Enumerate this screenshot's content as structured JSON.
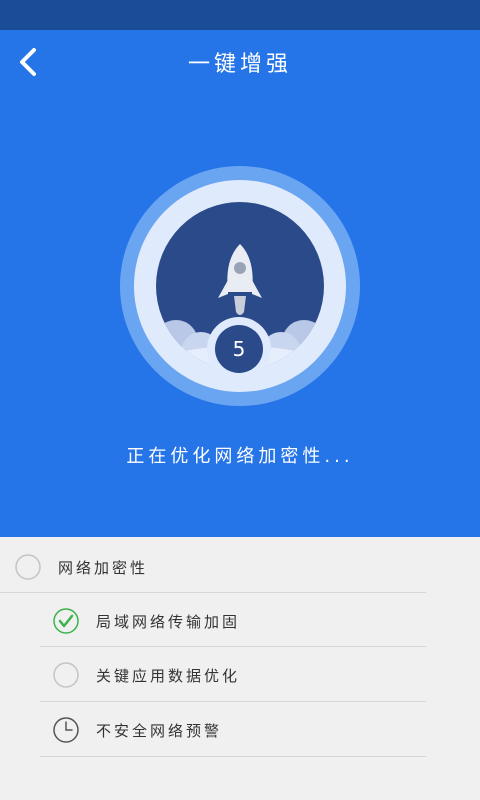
{
  "header": {
    "title": "一键增强"
  },
  "progress": {
    "countdown": "5",
    "status_text": "正在优化网络加密性..."
  },
  "list": {
    "section_title": "网络加密性",
    "items": [
      {
        "label": "局域网络传输加固",
        "state": "done"
      },
      {
        "label": "关键应用数据优化",
        "state": "pending"
      },
      {
        "label": "不安全网络预警",
        "state": "waiting"
      }
    ]
  },
  "colors": {
    "status_bar": "#1a4d98",
    "hero_bg": "#2574e8",
    "ring_outer": "#6aa5f2",
    "ring_light": "#dfeafd",
    "ring_inner": "#2b4a8a",
    "check_green": "#3cb34a",
    "list_bg": "#f0f0f0"
  },
  "icons": {
    "back": "chevron-left-icon",
    "rocket": "rocket-icon",
    "check": "check-circle-icon",
    "pending": "spinner-circle-icon",
    "clock": "clock-icon"
  }
}
